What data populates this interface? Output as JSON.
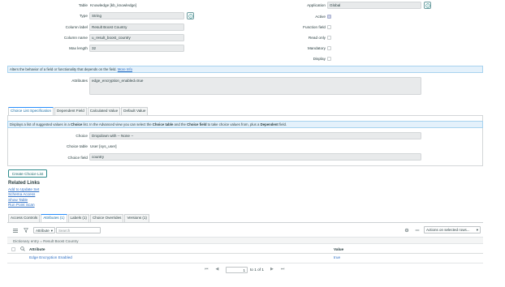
{
  "form": {
    "table": {
      "label": "Table",
      "value": "Knowledge [kb_knowledge]"
    },
    "type": {
      "label": "Type",
      "value": "String"
    },
    "column_label": {
      "label": "Column label",
      "value": "Result Boost Country"
    },
    "column_name": {
      "label": "Column name",
      "value": "u_result_boost_country"
    },
    "max_length": {
      "label": "Max length",
      "value": "32"
    },
    "application": {
      "label": "Application",
      "value": "Global"
    },
    "active": {
      "label": "Active",
      "checked": true
    },
    "function_field": {
      "label": "Function field",
      "checked": false
    },
    "read_only": {
      "label": "Read only",
      "checked": false
    },
    "mandatory": {
      "label": "Mandatory",
      "checked": false
    },
    "display": {
      "label": "Display",
      "checked": false
    },
    "attributes_info": "Alters the behavior of a field or functionality that depends on the field.",
    "more_info": "More Info",
    "attributes": {
      "label": "Attributes",
      "value": "edge_encryption_enabled=true"
    }
  },
  "section_tabs": [
    "Choice List Specification",
    "Dependent Field",
    "Calculated Value",
    "Default Value"
  ],
  "choice_spec": {
    "info_parts": {
      "p1": "Displays a list of suggested values in a ",
      "b1": "Choice",
      "p2": " list. In the Advanced view you can select the ",
      "b2": "Choice table",
      "p3": " and the ",
      "b3": "Choice field",
      "p4": " to take choice values from, plus a ",
      "b4": "Dependent",
      "p5": " field."
    },
    "choice": {
      "label": "Choice",
      "value": "Dropdown with -- None --"
    },
    "choice_table": {
      "label": "Choice table",
      "value": "User [sys_user]"
    },
    "choice_field": {
      "label": "Choice field",
      "value": "country"
    }
  },
  "create_choice_list": "Create Choice List",
  "related_links": {
    "title": "Related Links",
    "items": [
      "Add to Update Set",
      "Schema Access",
      "Show Table",
      "Run Point Scan"
    ]
  },
  "related_tabs": [
    "Access Controls",
    "Attributes (1)",
    "Labels (1)",
    "Choice Overrides",
    "Versions (1)"
  ],
  "list": {
    "filter_select": "Attribute",
    "search_placeholder": "Search",
    "actions_select": "Actions on selected rows...",
    "breadcrumb": "Dictionary entry = Result Boost Country",
    "columns": [
      "Attribute",
      "Value"
    ],
    "rows": [
      {
        "attribute": "Edge Encryption Enabled",
        "value": "true"
      }
    ],
    "pager": {
      "current": "1",
      "of_text": "to 1 of 1"
    }
  },
  "icons": {
    "type_lookup": "info-icon",
    "app_lookup": "info-icon",
    "menu": "hamburger-icon",
    "filter": "funnel-icon",
    "settings": "gear-icon",
    "collapse": "minus-icon"
  }
}
